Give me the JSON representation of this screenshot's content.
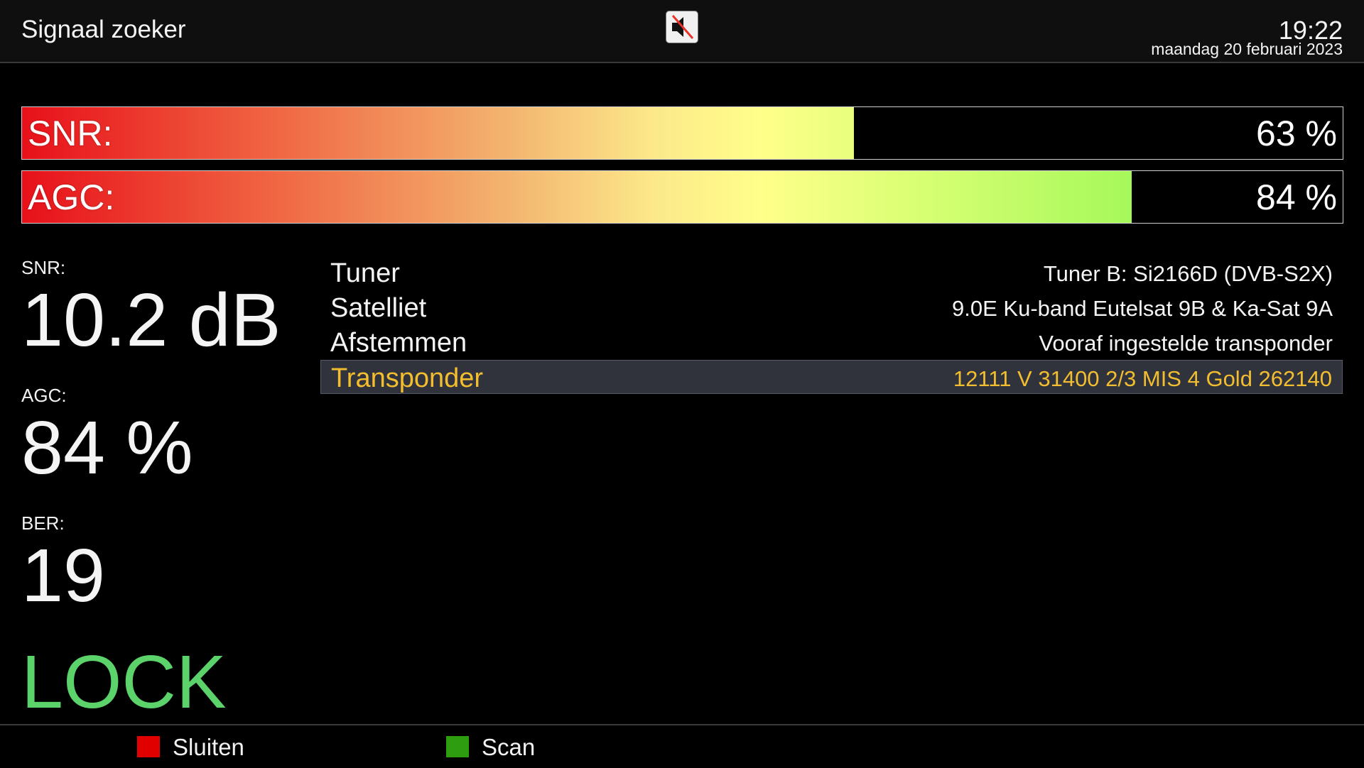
{
  "header": {
    "title": "Signaal zoeker",
    "mute_icon": "speaker-muted-icon",
    "time": "19:22",
    "date": "maandag 20 februari 2023"
  },
  "bars": [
    {
      "label": "SNR:",
      "value_text": "63 %",
      "level": 0.63
    },
    {
      "label": "AGC:",
      "value_text": "84 %",
      "level": 0.84
    }
  ],
  "stats": {
    "snr_label": "SNR:",
    "snr_value": "10.2 dB",
    "agc_label": "AGC:",
    "agc_value": "84 %",
    "ber_label": "BER:",
    "ber_value": "19",
    "lock_status": "LOCK"
  },
  "info": [
    {
      "key": "Tuner",
      "value": "Tuner B: Si2166D (DVB-S2X)"
    },
    {
      "key": "Satelliet",
      "value": "9.0E Ku-band Eutelsat 9B & Ka-Sat 9A"
    },
    {
      "key": "Afstemmen",
      "value": "Vooraf ingestelde transponder"
    },
    {
      "key": "Transponder",
      "value": "12111 V 31400 2/3 MIS 4 Gold 262140",
      "selected": true
    }
  ],
  "footer": {
    "red_label": "Sluiten",
    "green_label": "Scan"
  },
  "colors": {
    "background": "#000000",
    "lock_green": "#5bd36a",
    "selected_text": "#f3bd30",
    "red_key": "#e00000",
    "green_key": "#2e9e10"
  }
}
